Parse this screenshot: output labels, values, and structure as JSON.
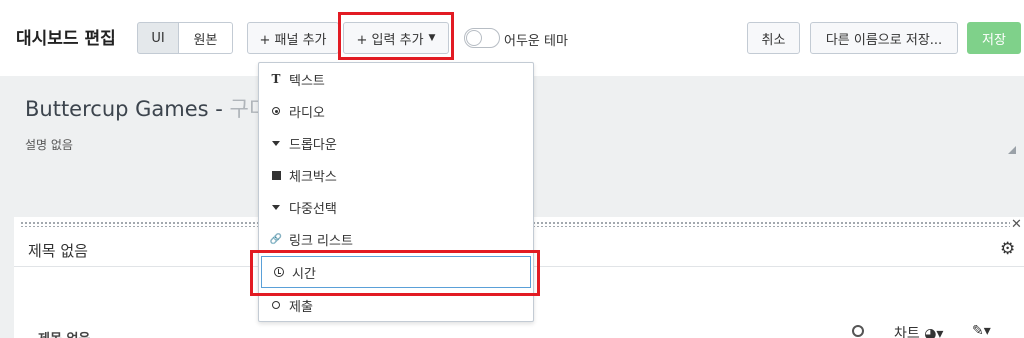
{
  "toolbar": {
    "title": "대시보드 편집",
    "seg_ui": "UI",
    "seg_source": "원본",
    "add_panel": "+ 패널 추가",
    "add_input": "+ 입력 추가",
    "dark_theme": "어두운 테마",
    "cancel": "취소",
    "save_as": "다른 이름으로 저장...",
    "save": "저장"
  },
  "dashboard": {
    "title": "Buttercup Games - ",
    "title_suffix": "구미",
    "description": "설명 없음"
  },
  "panel": {
    "title": "제목 없음",
    "subtitle": "제목 없음",
    "chart_label": "차트"
  },
  "menu": {
    "items": [
      {
        "label": "텍스트",
        "icon": "text-icon"
      },
      {
        "label": "라디오",
        "icon": "radio-icon"
      },
      {
        "label": "드롭다운",
        "icon": "dropdown-icon"
      },
      {
        "label": "체크박스",
        "icon": "checkbox-icon"
      },
      {
        "label": "다중선택",
        "icon": "multiselect-icon"
      },
      {
        "label": "링크 리스트",
        "icon": "link-icon"
      },
      {
        "label": "시간",
        "icon": "clock-icon"
      },
      {
        "label": "제출",
        "icon": "search-icon"
      }
    ]
  },
  "colors": {
    "highlight": "#e21b23",
    "save_button": "#7fd18a",
    "focus_border": "#5aa0d8"
  }
}
